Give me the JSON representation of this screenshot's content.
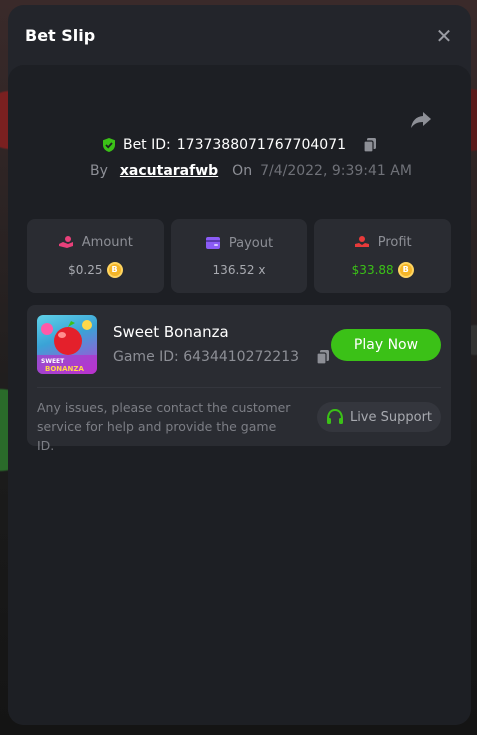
{
  "modal": {
    "title": "Bet Slip",
    "close_glyph": "✕"
  },
  "bet": {
    "id_label": "Bet ID:",
    "id_value": "1737388071767704071",
    "by_label": "By",
    "username": "xacutarafwb",
    "on_label": "On",
    "date": "7/4/2022, 9:39:41 AM"
  },
  "stats": {
    "amount": {
      "label": "Amount",
      "value": "$0.25",
      "icon": "amount-hand-icon",
      "color": "#e9407a"
    },
    "payout": {
      "label": "Payout",
      "value": "136.52 x",
      "icon": "wallet-icon",
      "color": "#8b5cf6"
    },
    "profit": {
      "label": "Profit",
      "value": "$33.88",
      "icon": "profit-hand-icon",
      "color": "#e83a3a",
      "value_color": "#3bc117"
    }
  },
  "game": {
    "name": "Sweet Bonanza",
    "id_label": "Game ID:",
    "id_value": "6434410272213",
    "play_label": "Play Now",
    "thumb_title": "SWEET BONANZA"
  },
  "support": {
    "message": "Any issues, please contact the customer service for help and provide the game ID.",
    "button_label": "Live Support"
  },
  "colors": {
    "accent_green": "#3bc117",
    "coin": "#f4b528",
    "shield": "#3bc117"
  }
}
